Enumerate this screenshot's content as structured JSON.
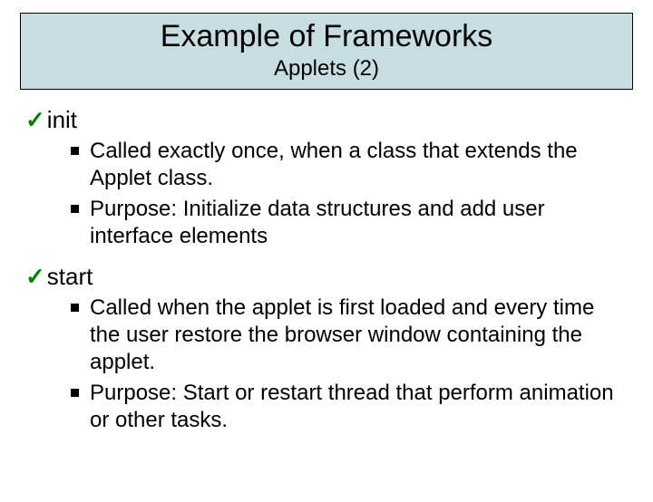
{
  "header": {
    "title": "Example of Frameworks",
    "subtitle": "Applets (2)"
  },
  "sections": [
    {
      "title": "init",
      "bullets": [
        "Called exactly once, when a class that extends the Applet class.",
        "Purpose: Initialize data structures and add user interface elements"
      ]
    },
    {
      "title": "start",
      "bullets": [
        "Called when the applet is first loaded and every time the user restore the browser window containing the applet.",
        "Purpose: Start or restart thread that perform animation or other tasks."
      ]
    }
  ]
}
